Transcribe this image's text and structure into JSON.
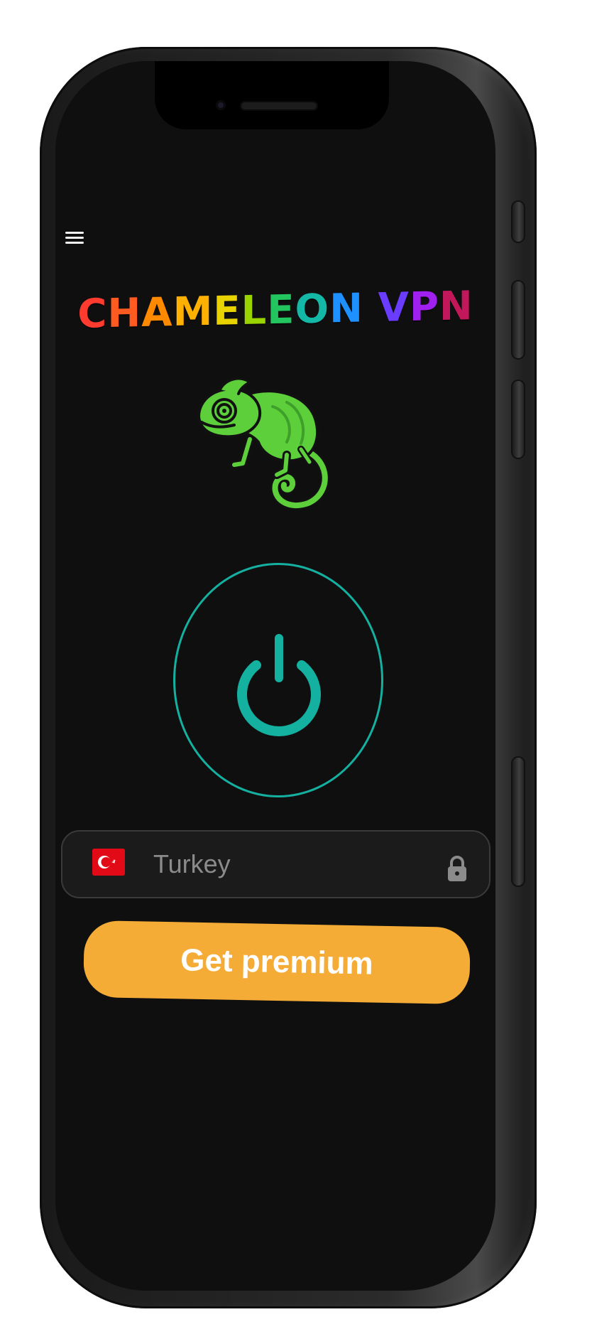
{
  "app": {
    "title_letters": [
      {
        "ch": "C",
        "color": "#ff3b30"
      },
      {
        "ch": "H",
        "color": "#ff5a1f"
      },
      {
        "ch": "A",
        "color": "#ff8a00"
      },
      {
        "ch": "M",
        "color": "#ffb000"
      },
      {
        "ch": "E",
        "color": "#e8d200"
      },
      {
        "ch": "L",
        "color": "#9ad400"
      },
      {
        "ch": "E",
        "color": "#22c55e"
      },
      {
        "ch": "O",
        "color": "#14b8a6"
      },
      {
        "ch": "N",
        "color": "#1e90ff"
      },
      {
        "ch": " ",
        "color": "#ffffff"
      },
      {
        "ch": "V",
        "color": "#6a3cff"
      },
      {
        "ch": "P",
        "color": "#a020f0"
      },
      {
        "ch": "N",
        "color": "#c2185b"
      }
    ]
  },
  "header": {
    "menu_icon": "hamburger-menu-icon"
  },
  "mascot": {
    "icon": "chameleon-mascot",
    "color": "#5ccf3a"
  },
  "connect": {
    "icon": "power-icon",
    "accent_color": "#14b0a0",
    "state": "disconnected"
  },
  "location": {
    "country": "Turkey",
    "flag_icon": "turkey-flag-icon",
    "lock_icon": "lock-icon"
  },
  "premium": {
    "label": "Get premium",
    "color": "#f5ac36"
  }
}
